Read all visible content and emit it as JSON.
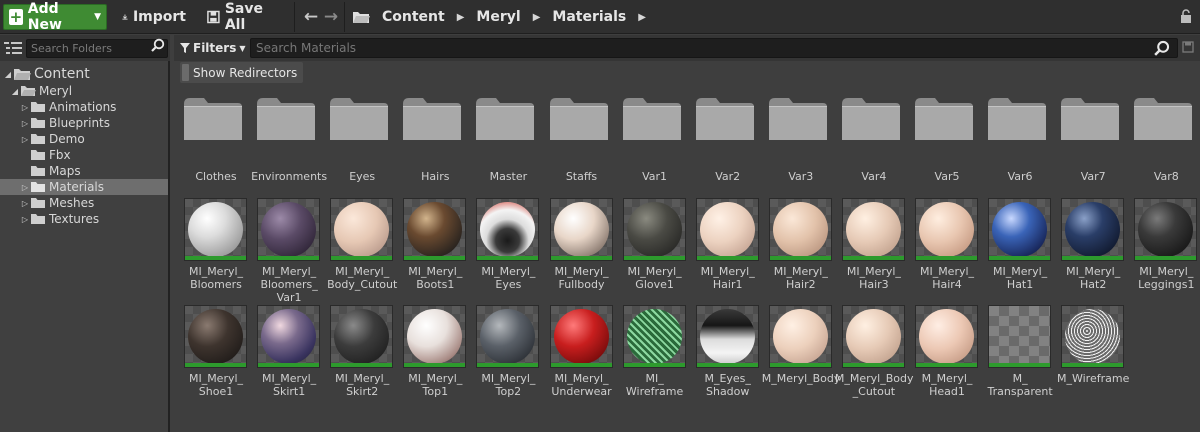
{
  "toolbar": {
    "add_new": "Add New",
    "import": "Import",
    "save_all": "Save All",
    "breadcrumb": [
      "Content",
      "Meryl",
      "Materials"
    ],
    "accent": "#3f8b33"
  },
  "sidebar": {
    "search_placeholder": "Search Folders",
    "root": "Content",
    "parent": "Meryl",
    "folders": [
      "Animations",
      "Blueprints",
      "Demo",
      "Fbx",
      "Maps",
      "Materials",
      "Meshes",
      "Textures"
    ],
    "selected": "Materials"
  },
  "content": {
    "filters_label": "Filters",
    "search_placeholder": "Search Materials",
    "show_redirectors": "Show Redirectors",
    "folders": [
      "Clothes",
      "Environments",
      "Eyes",
      "Hairs",
      "Master",
      "Staffs",
      "Var1",
      "Var2",
      "Var3",
      "Var4",
      "Var5",
      "Var6",
      "Var7",
      "Var8"
    ],
    "row1": [
      "MI_Meryl_\nBloomers",
      "MI_Meryl_\nBloomers_\nVar1",
      "MI_Meryl_\nBody_Cutout",
      "MI_Meryl_\nBoots1",
      "MI_Meryl_\nEyes",
      "MI_Meryl_\nFullbody",
      "MI_Meryl_\nGlove1",
      "MI_Meryl_\nHair1",
      "MI_Meryl_\nHair2",
      "MI_Meryl_\nHair3",
      "MI_Meryl_\nHair4",
      "MI_Meryl_\nHat1",
      "MI_Meryl_\nHat2",
      "MI_Meryl_\nLeggings1"
    ],
    "row2": [
      "MI_Meryl_\nShoe1",
      "MI_Meryl_\nSkirt1",
      "MI_Meryl_\nSkirt2",
      "MI_Meryl_\nTop1",
      "MI_Meryl_\nTop2",
      "MI_Meryl_\nUnderwear",
      "MI_\nWireframe",
      "M_Eyes_\nShadow",
      "M_Meryl_Body",
      "M_Meryl_Body\n_Cutout",
      "M_Meryl_\nHead1",
      "M_\nTransparent",
      "M_Wireframe"
    ]
  }
}
